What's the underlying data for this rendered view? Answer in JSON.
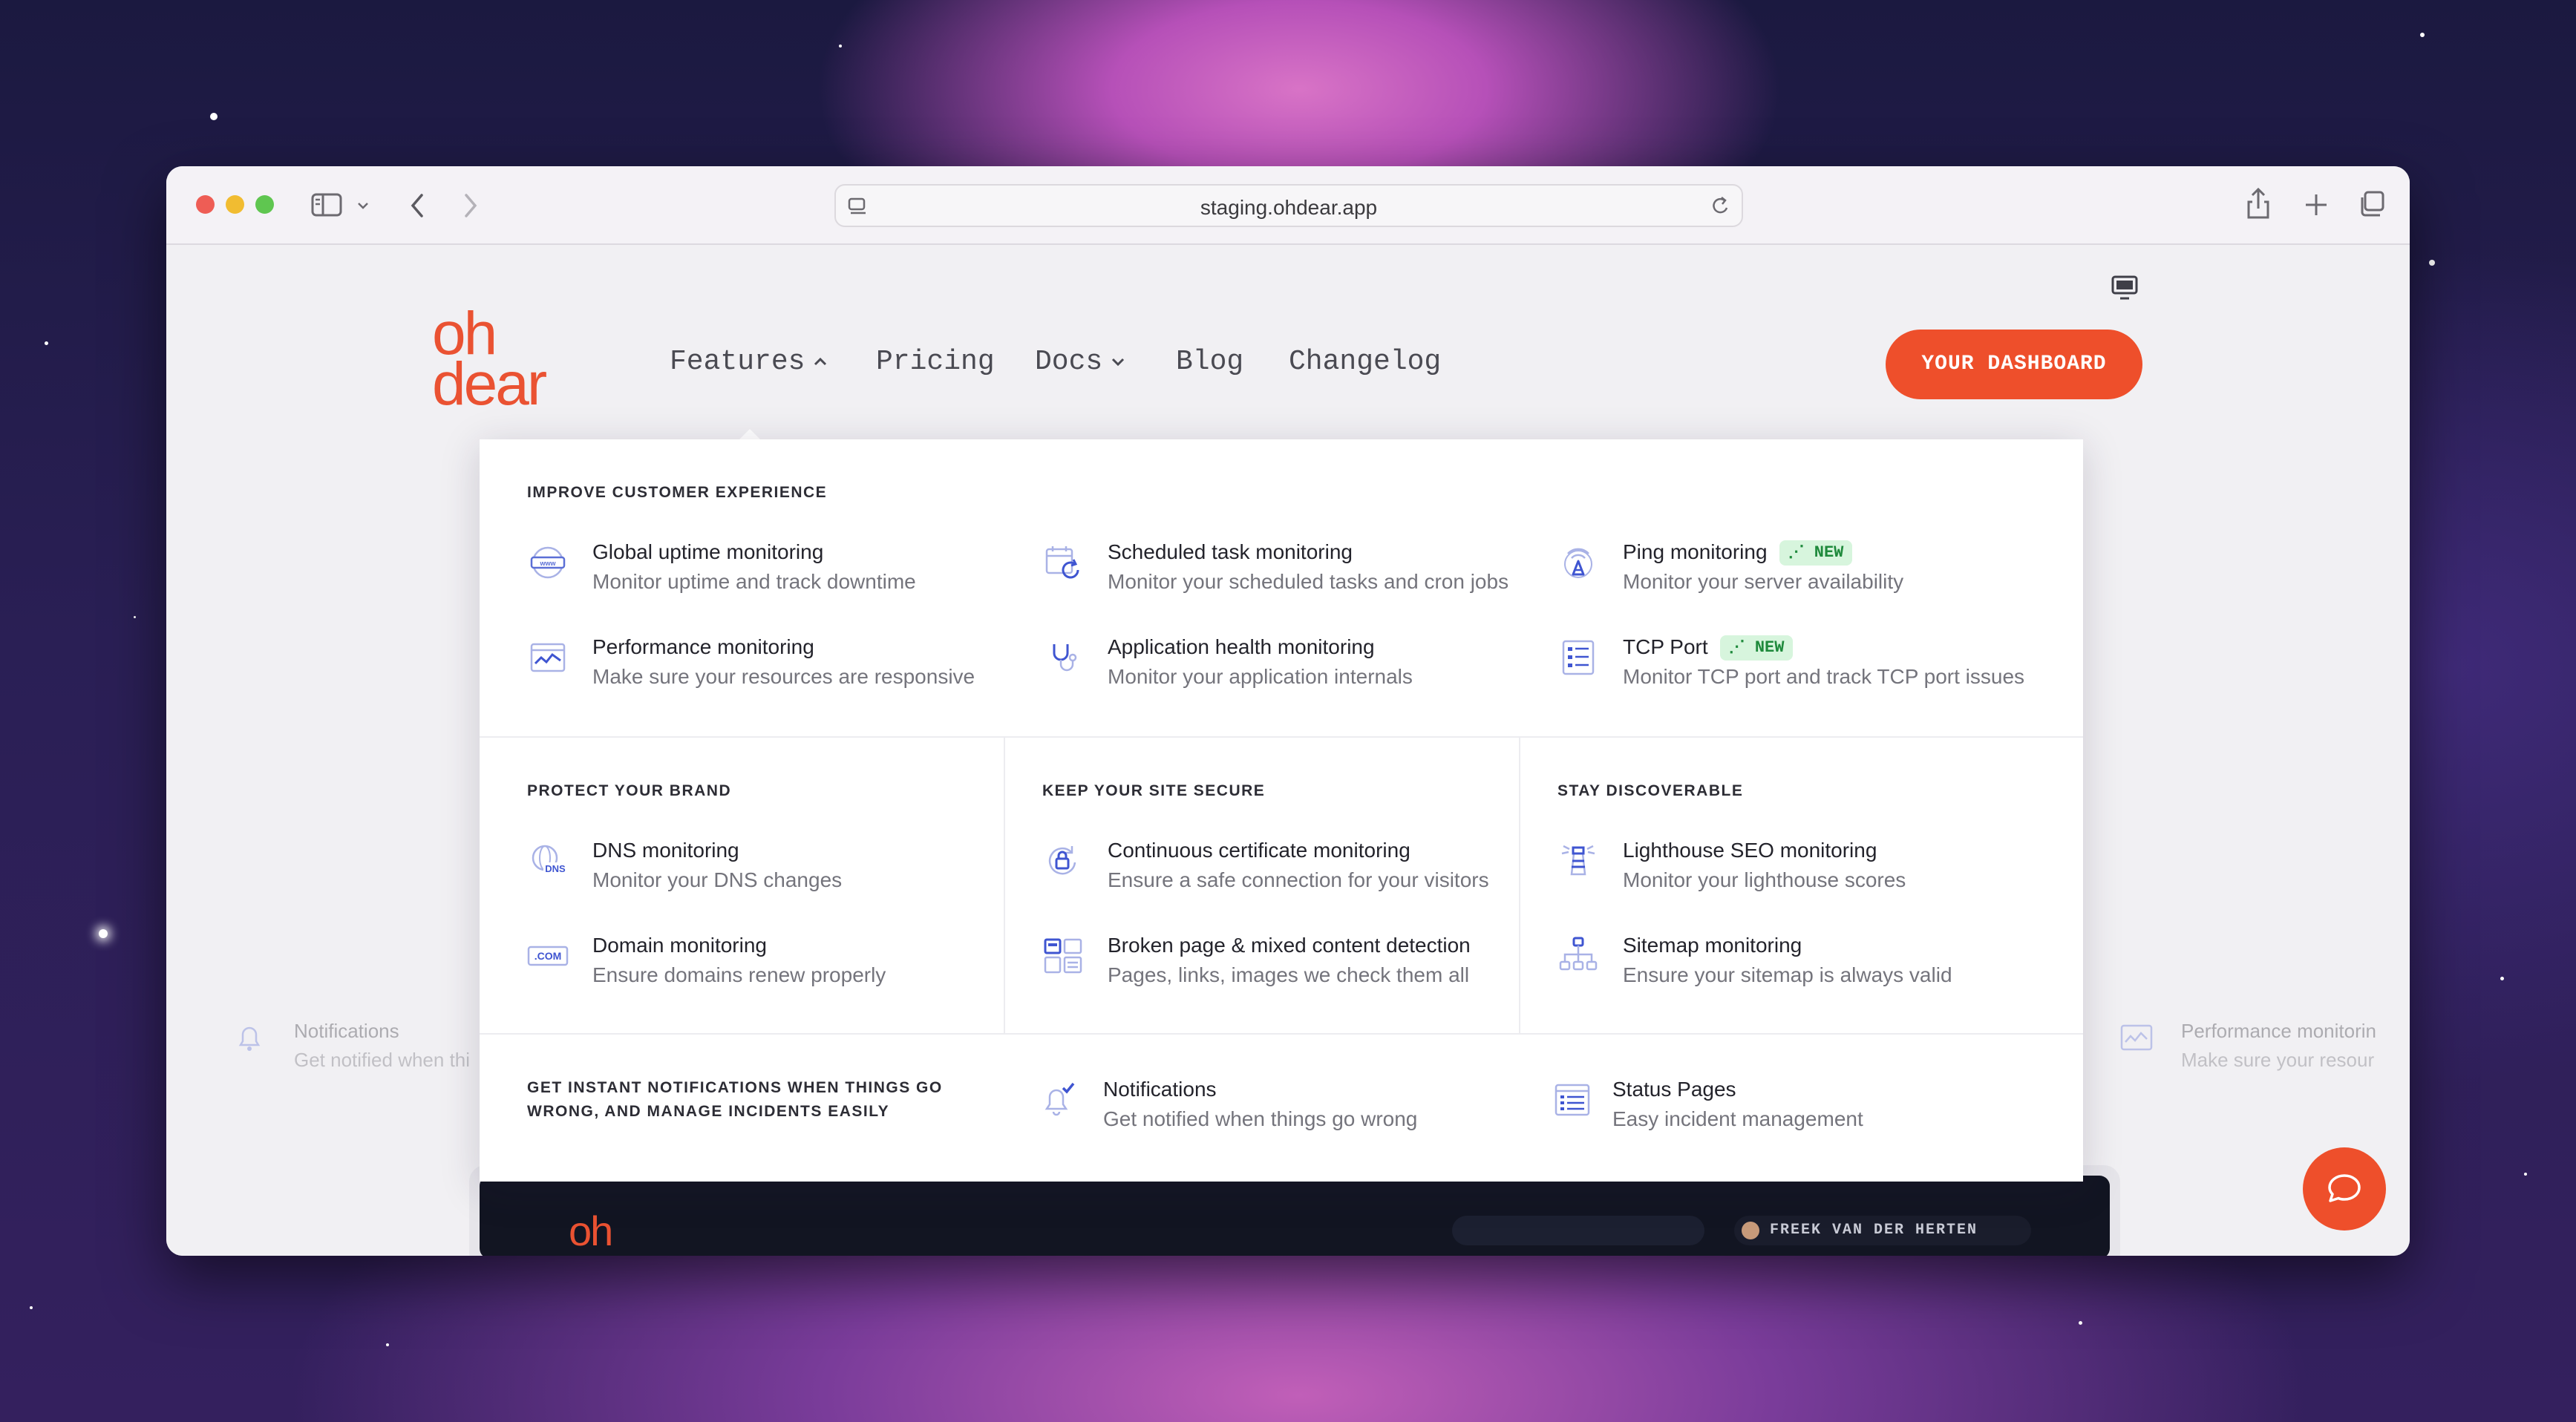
{
  "browser": {
    "url": "staging.ohdear.app"
  },
  "site": {
    "logo_line1": "oh",
    "logo_line2": "dear",
    "nav": {
      "features": "Features",
      "pricing": "Pricing",
      "docs": "Docs",
      "blog": "Blog",
      "changelog": "Changelog"
    },
    "dashboard_button": "YOUR DASHBOARD",
    "accent_color": "#ee4f2b"
  },
  "menu": {
    "improve": {
      "title": "IMPROVE CUSTOMER EXPERIENCE",
      "items": [
        {
          "title": "Global uptime monitoring",
          "subtitle": "Monitor uptime and track downtime",
          "icon": "www-globe-icon"
        },
        {
          "title": "Scheduled task monitoring",
          "subtitle": "Monitor your scheduled tasks and cron jobs",
          "icon": "calendar-refresh-icon"
        },
        {
          "title": "Ping monitoring",
          "subtitle": "Monitor your server availability",
          "icon": "antenna-icon",
          "badge": "NEW"
        },
        {
          "title": "Performance monitoring",
          "subtitle": "Make sure your resources are responsive",
          "icon": "performance-chart-icon"
        },
        {
          "title": "Application health monitoring",
          "subtitle": "Monitor your application internals",
          "icon": "stethoscope-icon"
        },
        {
          "title": "TCP Port",
          "subtitle": "Monitor TCP port and track TCP port issues",
          "icon": "server-list-icon",
          "badge": "NEW"
        }
      ]
    },
    "protect": {
      "title": "PROTECT YOUR BRAND",
      "items": [
        {
          "title": "DNS monitoring",
          "subtitle": "Monitor your DNS changes",
          "icon": "dns-globe-icon"
        },
        {
          "title": "Domain monitoring",
          "subtitle": "Ensure domains renew properly",
          "icon": "dot-com-icon"
        }
      ]
    },
    "secure": {
      "title": "KEEP YOUR SITE SECURE",
      "items": [
        {
          "title": "Continuous certificate monitoring",
          "subtitle": "Ensure a safe connection for your visitors",
          "icon": "lock-refresh-icon"
        },
        {
          "title": "Broken page & mixed content detection",
          "subtitle": "Pages, links, images we check them all",
          "icon": "grid-pages-icon"
        }
      ]
    },
    "discoverable": {
      "title": "STAY DISCOVERABLE",
      "items": [
        {
          "title": "Lighthouse SEO monitoring",
          "subtitle": "Monitor your lighthouse scores",
          "icon": "lighthouse-icon"
        },
        {
          "title": "Sitemap monitoring",
          "subtitle": "Ensure your sitemap is always valid",
          "icon": "sitemap-icon"
        }
      ]
    },
    "notifications": {
      "title_line1": "GET INSTANT NOTIFICATIONS WHEN THINGS GO",
      "title_line2": "WRONG, AND MANAGE INCIDENTS EASILY",
      "items": [
        {
          "title": "Notifications",
          "subtitle": "Get notified when things go wrong",
          "icon": "bell-check-icon"
        },
        {
          "title": "Status Pages",
          "subtitle": "Easy incident management",
          "icon": "status-list-icon"
        }
      ]
    }
  },
  "background": {
    "left_ghost": {
      "title": "Notifications",
      "subtitle": "Get notified when thi"
    },
    "right_ghost": {
      "title": "Performance monitorin",
      "subtitle": "Make sure your resour"
    },
    "preview_user": "FREEK VAN DER HERTEN",
    "preview_logo": "oh"
  }
}
